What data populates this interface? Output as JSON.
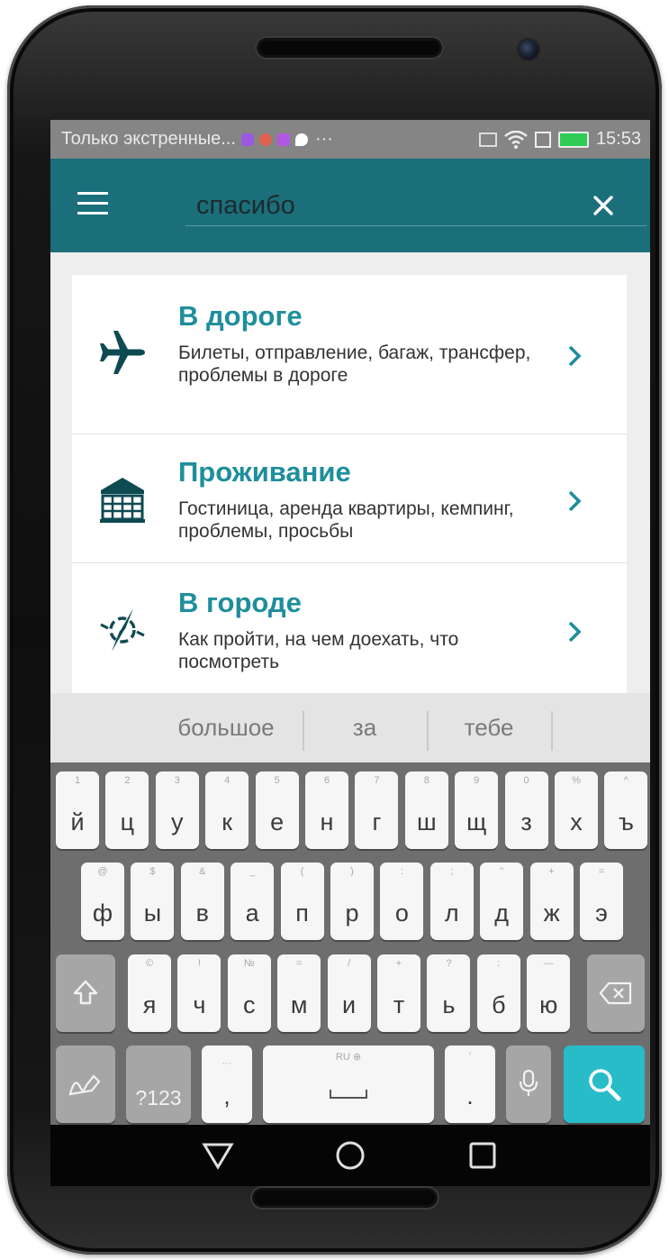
{
  "status_bar": {
    "notification_text": "Только экстренные...",
    "overflow": "···",
    "time": "15:53",
    "icons": [
      "nfc-icon",
      "wifi-icon",
      "sim-icon",
      "battery-icon"
    ]
  },
  "toolbar": {
    "search_value": "спасибо",
    "accent_color": "#1a6f7b"
  },
  "categories": [
    {
      "title": "В дороге",
      "description": "Билеты, отправление, багаж, трансфер, проблемы в дороге",
      "icon": "airplane-icon"
    },
    {
      "title": "Проживание",
      "description": "Гостиница, аренда квартиры, кемпинг, проблемы, просьбы",
      "icon": "building-icon"
    },
    {
      "title": "В городе",
      "description": "Как пройти, на чем доехать, что посмотреть",
      "icon": "compass-icon"
    }
  ],
  "keyboard": {
    "suggestions": [
      "большое",
      "за",
      "тебе"
    ],
    "row1": [
      {
        "k": "й",
        "h": "1"
      },
      {
        "k": "ц",
        "h": "2"
      },
      {
        "k": "у",
        "h": "3"
      },
      {
        "k": "к",
        "h": "4"
      },
      {
        "k": "е",
        "h": "5"
      },
      {
        "k": "н",
        "h": "6"
      },
      {
        "k": "г",
        "h": "7"
      },
      {
        "k": "ш",
        "h": "8"
      },
      {
        "k": "щ",
        "h": "9"
      },
      {
        "k": "з",
        "h": "0"
      },
      {
        "k": "х",
        "h": "%"
      },
      {
        "k": "ъ",
        "h": "^"
      }
    ],
    "row2": [
      {
        "k": "ф",
        "h": "@"
      },
      {
        "k": "ы",
        "h": "$"
      },
      {
        "k": "в",
        "h": "&"
      },
      {
        "k": "а",
        "h": "_"
      },
      {
        "k": "п",
        "h": "("
      },
      {
        "k": "р",
        "h": ")"
      },
      {
        "k": "о",
        "h": ":"
      },
      {
        "k": "л",
        "h": ";"
      },
      {
        "k": "д",
        "h": "\""
      },
      {
        "k": "ж",
        "h": "+"
      },
      {
        "k": "э",
        "h": "="
      }
    ],
    "row3": [
      {
        "k": "я",
        "h": "©"
      },
      {
        "k": "ч",
        "h": "!"
      },
      {
        "k": "с",
        "h": "№"
      },
      {
        "k": "м",
        "h": "="
      },
      {
        "k": "и",
        "h": "/"
      },
      {
        "k": "т",
        "h": "+"
      },
      {
        "k": "ь",
        "h": "?"
      },
      {
        "k": "б",
        "h": ":"
      },
      {
        "k": "ю",
        "h": "—"
      }
    ],
    "symbols_label": "?123",
    "comma": ",",
    "comma_hint": "···",
    "space_label": "RU ⊕",
    "period": ".",
    "period_hint": "'"
  }
}
